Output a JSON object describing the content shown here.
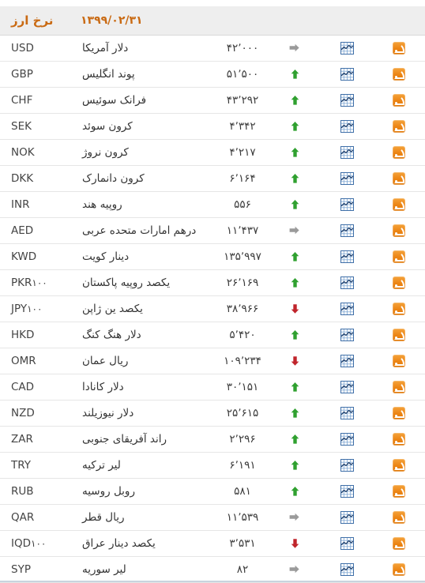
{
  "header": {
    "title": "نرخ ارز",
    "date": "۱۳۹۹/۰۲/۳۱"
  },
  "icons": {
    "rss": "rss-icon",
    "chart": "chart-icon",
    "trend_up": "arrow-up-icon",
    "trend_down": "arrow-down-icon",
    "trend_flat": "arrow-right-icon"
  },
  "colors": {
    "header_text": "#c96a13",
    "header_bg": "#eeeeee",
    "up": "#2fa02f",
    "down": "#c0242b",
    "flat": "#9a9a9a",
    "rss_orange": "#ec8413",
    "chart_blue": "#4a7ebb",
    "row_border": "#e6e6e6"
  },
  "rows": [
    {
      "code": "USD",
      "mult": "",
      "name": "دلار آمریکا",
      "value": "۴۲٬۰۰۰",
      "trend": "flat"
    },
    {
      "code": "GBP",
      "mult": "",
      "name": "پوند انگلیس",
      "value": "۵۱٬۵۰۰",
      "trend": "up"
    },
    {
      "code": "CHF",
      "mult": "",
      "name": "فرانک سوئیس",
      "value": "۴۳٬۲۹۲",
      "trend": "up"
    },
    {
      "code": "SEK",
      "mult": "",
      "name": "کرون سوئد",
      "value": "۴٬۳۴۲",
      "trend": "up"
    },
    {
      "code": "NOK",
      "mult": "",
      "name": "کرون نروژ",
      "value": "۴٬۲۱۷",
      "trend": "up"
    },
    {
      "code": "DKK",
      "mult": "",
      "name": "کرون دانمارک",
      "value": "۶٬۱۶۴",
      "trend": "up"
    },
    {
      "code": "INR",
      "mult": "",
      "name": "روپیه هند",
      "value": "۵۵۶",
      "trend": "up"
    },
    {
      "code": "AED",
      "mult": "",
      "name": "درهم امارات متحده عربی",
      "value": "۱۱٬۴۳۷",
      "trend": "flat"
    },
    {
      "code": "KWD",
      "mult": "",
      "name": "دینار کویت",
      "value": "۱۳۵٬۹۹۷",
      "trend": "up"
    },
    {
      "code": "PKR",
      "mult": "۱۰۰",
      "name": "یکصد روپیه پاکستان",
      "value": "۲۶٬۱۶۹",
      "trend": "up"
    },
    {
      "code": "JPY",
      "mult": "۱۰۰",
      "name": "یکصد ین ژاپن",
      "value": "۳۸٬۹۶۶",
      "trend": "down"
    },
    {
      "code": "HKD",
      "mult": "",
      "name": "دلار هنگ کنگ",
      "value": "۵٬۴۲۰",
      "trend": "up"
    },
    {
      "code": "OMR",
      "mult": "",
      "name": "ریال عمان",
      "value": "۱۰۹٬۲۳۴",
      "trend": "down"
    },
    {
      "code": "CAD",
      "mult": "",
      "name": "دلار کانادا",
      "value": "۳۰٬۱۵۱",
      "trend": "up"
    },
    {
      "code": "NZD",
      "mult": "",
      "name": "دلار نیوزیلند",
      "value": "۲۵٬۶۱۵",
      "trend": "up"
    },
    {
      "code": "ZAR",
      "mult": "",
      "name": "راند آفریقای جنوبی",
      "value": "۲٬۲۹۶",
      "trend": "up"
    },
    {
      "code": "TRY",
      "mult": "",
      "name": "لیر ترکیه",
      "value": "۶٬۱۹۱",
      "trend": "up"
    },
    {
      "code": "RUB",
      "mult": "",
      "name": "روبل روسیه",
      "value": "۵۸۱",
      "trend": "up"
    },
    {
      "code": "QAR",
      "mult": "",
      "name": "ریال قطر",
      "value": "۱۱٬۵۳۹",
      "trend": "flat"
    },
    {
      "code": "IQD",
      "mult": "۱۰۰",
      "name": "یکصد دینار عراق",
      "value": "۳٬۵۳۱",
      "trend": "down"
    },
    {
      "code": "SYP",
      "mult": "",
      "name": "لیر سوریه",
      "value": "۸۲",
      "trend": "flat"
    }
  ]
}
